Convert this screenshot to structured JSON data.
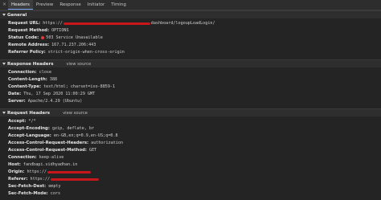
{
  "tabs": [
    {
      "label": "Headers"
    },
    {
      "label": "Preview"
    },
    {
      "label": "Response"
    },
    {
      "label": "Initiator"
    },
    {
      "label": "Timing"
    }
  ],
  "close_glyph": "×",
  "general": {
    "title": "General",
    "request_url_key": "Request URL:",
    "request_url_prefix": "https://",
    "request_url_suffix": "dashboard/logoupLoadLogin/",
    "request_method_key": "Request Method:",
    "request_method": "OPTIONS",
    "status_code_key": "Status Code:",
    "status_code": "503 Service Unavailable",
    "status_color": "#e53935",
    "remote_address_key": "Remote Address:",
    "remote_address": "167.71.237.206:443",
    "referrer_policy_key": "Referrer Policy:",
    "referrer_policy": "strict-origin-when-cross-origin"
  },
  "response_headers": {
    "title": "Response Headers",
    "view_source": "view source",
    "items": [
      {
        "key": "Connection:",
        "value": "close"
      },
      {
        "key": "Content-Length:",
        "value": "388"
      },
      {
        "key": "Content-Type:",
        "value": "text/html; charset=iso-8859-1"
      },
      {
        "key": "Date:",
        "value": "Thu, 17 Sep 2020 11:00:29 GMT"
      },
      {
        "key": "Server:",
        "value": "Apache/2.4.29 (Ubuntu)"
      }
    ]
  },
  "request_headers": {
    "title": "Request Headers",
    "view_source": "view source",
    "accept_key": "Accept:",
    "accept": "*/*",
    "accept_encoding_key": "Accept-Encoding:",
    "accept_encoding": "gzip, deflate, br",
    "accept_language_key": "Accept-Language:",
    "accept_language": "en-GB,en;q=0.9,en-US;q=0.8",
    "acrh_key": "Access-Control-Request-Headers:",
    "acrh": "authorization",
    "acrm_key": "Access-Control-Request-Method:",
    "acrm": "GET",
    "connection_key": "Connection:",
    "connection": "keep-alive",
    "host_key": "Host:",
    "host": "fandbapi.vidhyadhan.in",
    "origin_key": "Origin:",
    "origin_prefix": "https://",
    "referer_key": "Referer:",
    "referer_prefix": "https://",
    "sec_fetch_dest_key": "Sec-Fetch-Dest:",
    "sec_fetch_dest": "empty",
    "sec_fetch_mode_key": "Sec-Fetch-Mode:",
    "sec_fetch_mode": "cors"
  },
  "colors": {
    "redaction": "#c8161d",
    "active_tab_underline": "#7cacf8",
    "background": "#242424"
  }
}
